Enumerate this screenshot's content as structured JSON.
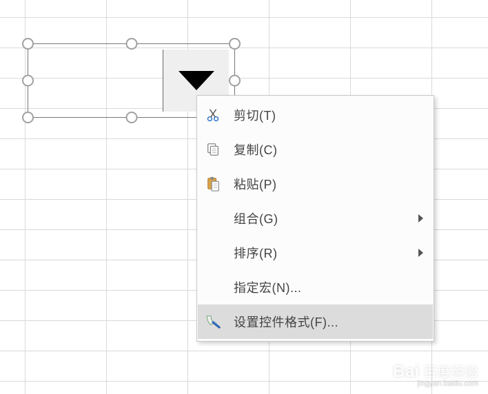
{
  "menu": {
    "items": [
      {
        "label": "剪切(T)",
        "icon": "cut-icon",
        "submenu": false
      },
      {
        "label": "复制(C)",
        "icon": "copy-icon",
        "submenu": false
      },
      {
        "label": "粘贴(P)",
        "icon": "paste-icon",
        "submenu": false
      },
      {
        "label": "组合(G)",
        "icon": null,
        "submenu": true
      },
      {
        "label": "排序(R)",
        "icon": null,
        "submenu": true
      },
      {
        "label": "指定宏(N)...",
        "icon": null,
        "submenu": false
      },
      {
        "label": "设置控件格式(F)...",
        "icon": "format-icon",
        "submenu": false,
        "highlight": true
      }
    ]
  },
  "watermark": {
    "main": "Bai",
    "cn": "百度经验",
    "sub": "jingyan.baidu.com"
  }
}
